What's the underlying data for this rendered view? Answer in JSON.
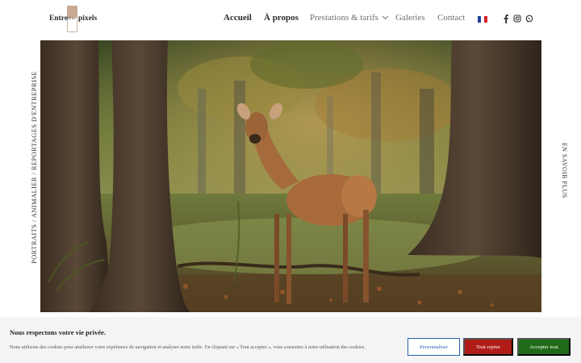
{
  "logo": {
    "word1": "Entre",
    "word2": "deux",
    "word3": "pixels"
  },
  "nav": {
    "items": [
      {
        "label": "Accueil",
        "active": true
      },
      {
        "label": "À propos",
        "active": true
      },
      {
        "label": "Prestations & tarifs",
        "active": false,
        "has_dropdown": true
      },
      {
        "label": "Galeries",
        "active": false
      },
      {
        "label": "Contact",
        "active": false
      }
    ]
  },
  "language": {
    "icon": "flag-fr-icon"
  },
  "social": {
    "icons": [
      "facebook-icon",
      "instagram-icon",
      "whatsapp-icon"
    ]
  },
  "hero": {
    "side_left": "PORTRAITS / ANIMALIER / REPORTAGES D'ENTREPRISE",
    "side_right": "EN SAVOIR PLUS",
    "image_alt": "deer-in-forest-photo"
  },
  "cookie": {
    "title": "Nous respectons votre vie privée.",
    "text": "Nous utilisons des cookies pour améliorer votre expérience de navigation et analyser notre trafic. En cliquant sur « Tout accepter », vous consentez à notre utilisation des cookies.",
    "customize_label": "Personnaliser",
    "reject_label": "Tout rejeter",
    "accept_label": "Accepter tout"
  },
  "colors": {
    "accent_blue": "#2563b0",
    "reject_red": "#b01c17",
    "accept_green": "#1f6a16"
  }
}
